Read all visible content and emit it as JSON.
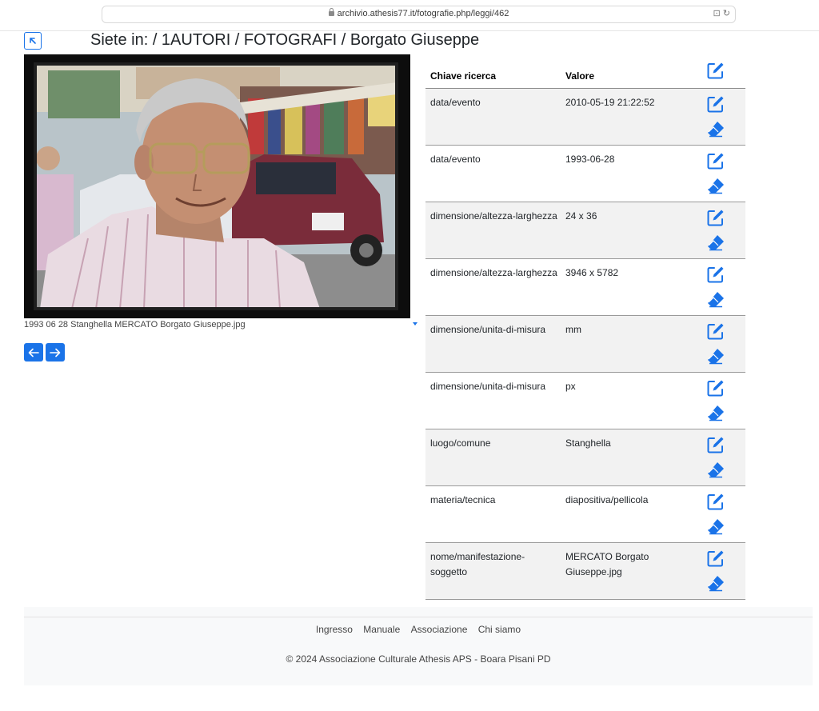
{
  "browser": {
    "url": "archivio.athesis77.it/fotografie.php/leggi/462",
    "right_icons": "⊡ ↻"
  },
  "header": {
    "title": "Siete in: / 1AUTORI / FOTOGRAFI / Borgato Giuseppe"
  },
  "photo": {
    "caption": "1993 06 28 Stanghella MERCATO Borgato Giuseppe.jpg"
  },
  "table": {
    "col_key": "Chiave ricerca",
    "col_value": "Valore",
    "rows": [
      {
        "key": "data/evento",
        "value": "2010-05-19 21:22:52"
      },
      {
        "key": "data/evento",
        "value": "1993-06-28"
      },
      {
        "key": "dimensione/altezza-larghezza",
        "value": "24 x 36"
      },
      {
        "key": "dimensione/altezza-larghezza",
        "value": "3946 x 5782"
      },
      {
        "key": "dimensione/unita-di-misura",
        "value": "mm"
      },
      {
        "key": "dimensione/unita-di-misura",
        "value": "px"
      },
      {
        "key": "luogo/comune",
        "value": "Stanghella"
      },
      {
        "key": "materia/tecnica",
        "value": "diapositiva/pellicola"
      },
      {
        "key": "nome/manifestazione-soggetto",
        "value": "MERCATO Borgato Giuseppe.jpg"
      }
    ]
  },
  "footer": {
    "links": [
      "Ingresso",
      "Manuale",
      "Associazione",
      "Chi siamo"
    ],
    "copyright": "© 2024 Associazione Culturale Athesis APS - Boara Pisani PD"
  },
  "colors": {
    "accent": "#1a73e8",
    "row_alt": "#f2f2f2"
  }
}
